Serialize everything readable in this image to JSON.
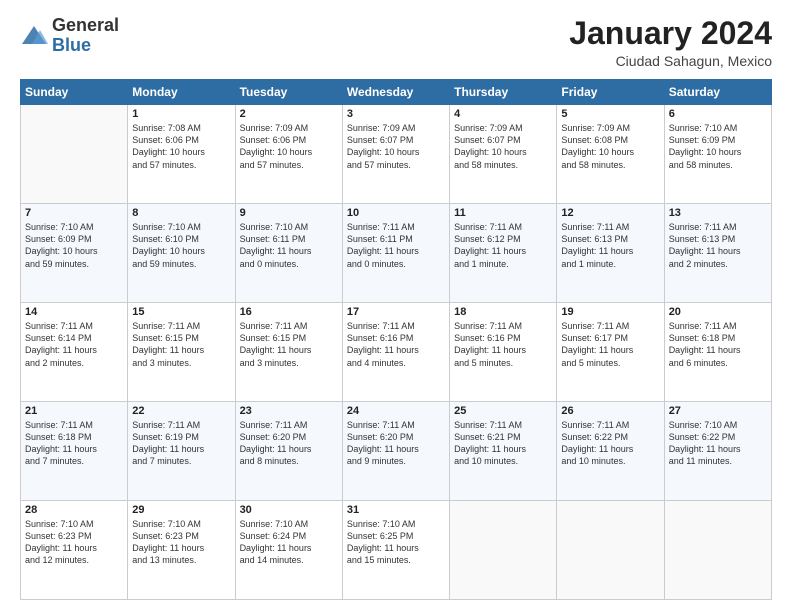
{
  "logo": {
    "general": "General",
    "blue": "Blue"
  },
  "header": {
    "month_year": "January 2024",
    "location": "Ciudad Sahagun, Mexico"
  },
  "days_header": [
    "Sunday",
    "Monday",
    "Tuesday",
    "Wednesday",
    "Thursday",
    "Friday",
    "Saturday"
  ],
  "weeks": [
    [
      {
        "num": "",
        "lines": []
      },
      {
        "num": "1",
        "lines": [
          "Sunrise: 7:08 AM",
          "Sunset: 6:06 PM",
          "Daylight: 10 hours",
          "and 57 minutes."
        ]
      },
      {
        "num": "2",
        "lines": [
          "Sunrise: 7:09 AM",
          "Sunset: 6:06 PM",
          "Daylight: 10 hours",
          "and 57 minutes."
        ]
      },
      {
        "num": "3",
        "lines": [
          "Sunrise: 7:09 AM",
          "Sunset: 6:07 PM",
          "Daylight: 10 hours",
          "and 57 minutes."
        ]
      },
      {
        "num": "4",
        "lines": [
          "Sunrise: 7:09 AM",
          "Sunset: 6:07 PM",
          "Daylight: 10 hours",
          "and 58 minutes."
        ]
      },
      {
        "num": "5",
        "lines": [
          "Sunrise: 7:09 AM",
          "Sunset: 6:08 PM",
          "Daylight: 10 hours",
          "and 58 minutes."
        ]
      },
      {
        "num": "6",
        "lines": [
          "Sunrise: 7:10 AM",
          "Sunset: 6:09 PM",
          "Daylight: 10 hours",
          "and 58 minutes."
        ]
      }
    ],
    [
      {
        "num": "7",
        "lines": [
          "Sunrise: 7:10 AM",
          "Sunset: 6:09 PM",
          "Daylight: 10 hours",
          "and 59 minutes."
        ]
      },
      {
        "num": "8",
        "lines": [
          "Sunrise: 7:10 AM",
          "Sunset: 6:10 PM",
          "Daylight: 10 hours",
          "and 59 minutes."
        ]
      },
      {
        "num": "9",
        "lines": [
          "Sunrise: 7:10 AM",
          "Sunset: 6:11 PM",
          "Daylight: 11 hours",
          "and 0 minutes."
        ]
      },
      {
        "num": "10",
        "lines": [
          "Sunrise: 7:11 AM",
          "Sunset: 6:11 PM",
          "Daylight: 11 hours",
          "and 0 minutes."
        ]
      },
      {
        "num": "11",
        "lines": [
          "Sunrise: 7:11 AM",
          "Sunset: 6:12 PM",
          "Daylight: 11 hours",
          "and 1 minute."
        ]
      },
      {
        "num": "12",
        "lines": [
          "Sunrise: 7:11 AM",
          "Sunset: 6:13 PM",
          "Daylight: 11 hours",
          "and 1 minute."
        ]
      },
      {
        "num": "13",
        "lines": [
          "Sunrise: 7:11 AM",
          "Sunset: 6:13 PM",
          "Daylight: 11 hours",
          "and 2 minutes."
        ]
      }
    ],
    [
      {
        "num": "14",
        "lines": [
          "Sunrise: 7:11 AM",
          "Sunset: 6:14 PM",
          "Daylight: 11 hours",
          "and 2 minutes."
        ]
      },
      {
        "num": "15",
        "lines": [
          "Sunrise: 7:11 AM",
          "Sunset: 6:15 PM",
          "Daylight: 11 hours",
          "and 3 minutes."
        ]
      },
      {
        "num": "16",
        "lines": [
          "Sunrise: 7:11 AM",
          "Sunset: 6:15 PM",
          "Daylight: 11 hours",
          "and 3 minutes."
        ]
      },
      {
        "num": "17",
        "lines": [
          "Sunrise: 7:11 AM",
          "Sunset: 6:16 PM",
          "Daylight: 11 hours",
          "and 4 minutes."
        ]
      },
      {
        "num": "18",
        "lines": [
          "Sunrise: 7:11 AM",
          "Sunset: 6:16 PM",
          "Daylight: 11 hours",
          "and 5 minutes."
        ]
      },
      {
        "num": "19",
        "lines": [
          "Sunrise: 7:11 AM",
          "Sunset: 6:17 PM",
          "Daylight: 11 hours",
          "and 5 minutes."
        ]
      },
      {
        "num": "20",
        "lines": [
          "Sunrise: 7:11 AM",
          "Sunset: 6:18 PM",
          "Daylight: 11 hours",
          "and 6 minutes."
        ]
      }
    ],
    [
      {
        "num": "21",
        "lines": [
          "Sunrise: 7:11 AM",
          "Sunset: 6:18 PM",
          "Daylight: 11 hours",
          "and 7 minutes."
        ]
      },
      {
        "num": "22",
        "lines": [
          "Sunrise: 7:11 AM",
          "Sunset: 6:19 PM",
          "Daylight: 11 hours",
          "and 7 minutes."
        ]
      },
      {
        "num": "23",
        "lines": [
          "Sunrise: 7:11 AM",
          "Sunset: 6:20 PM",
          "Daylight: 11 hours",
          "and 8 minutes."
        ]
      },
      {
        "num": "24",
        "lines": [
          "Sunrise: 7:11 AM",
          "Sunset: 6:20 PM",
          "Daylight: 11 hours",
          "and 9 minutes."
        ]
      },
      {
        "num": "25",
        "lines": [
          "Sunrise: 7:11 AM",
          "Sunset: 6:21 PM",
          "Daylight: 11 hours",
          "and 10 minutes."
        ]
      },
      {
        "num": "26",
        "lines": [
          "Sunrise: 7:11 AM",
          "Sunset: 6:22 PM",
          "Daylight: 11 hours",
          "and 10 minutes."
        ]
      },
      {
        "num": "27",
        "lines": [
          "Sunrise: 7:10 AM",
          "Sunset: 6:22 PM",
          "Daylight: 11 hours",
          "and 11 minutes."
        ]
      }
    ],
    [
      {
        "num": "28",
        "lines": [
          "Sunrise: 7:10 AM",
          "Sunset: 6:23 PM",
          "Daylight: 11 hours",
          "and 12 minutes."
        ]
      },
      {
        "num": "29",
        "lines": [
          "Sunrise: 7:10 AM",
          "Sunset: 6:23 PM",
          "Daylight: 11 hours",
          "and 13 minutes."
        ]
      },
      {
        "num": "30",
        "lines": [
          "Sunrise: 7:10 AM",
          "Sunset: 6:24 PM",
          "Daylight: 11 hours",
          "and 14 minutes."
        ]
      },
      {
        "num": "31",
        "lines": [
          "Sunrise: 7:10 AM",
          "Sunset: 6:25 PM",
          "Daylight: 11 hours",
          "and 15 minutes."
        ]
      },
      {
        "num": "",
        "lines": []
      },
      {
        "num": "",
        "lines": []
      },
      {
        "num": "",
        "lines": []
      }
    ]
  ]
}
